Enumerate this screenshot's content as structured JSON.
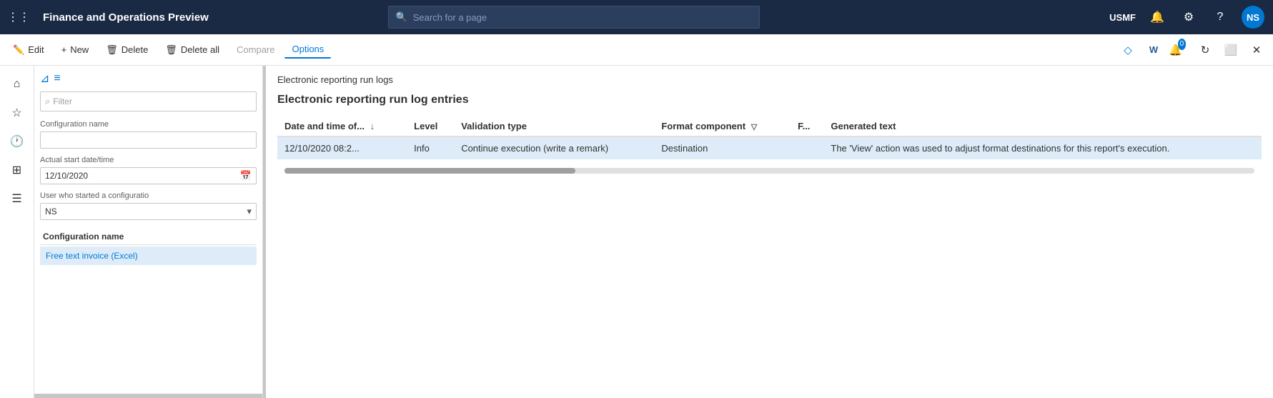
{
  "app": {
    "title": "Finance and Operations Preview",
    "avatar": "NS",
    "user": "USMF"
  },
  "search": {
    "placeholder": "Search for a page"
  },
  "action_bar": {
    "edit_label": "Edit",
    "new_label": "New",
    "delete_label": "Delete",
    "delete_all_label": "Delete all",
    "compare_label": "Compare",
    "options_label": "Options"
  },
  "filter": {
    "placeholder": "Filter",
    "config_name_label": "Configuration name",
    "config_name_value": "",
    "start_date_label": "Actual start date/time",
    "start_date_value": "12/10/2020",
    "user_label": "User who started a configuratio",
    "user_value": "NS",
    "list_column": "Configuration name",
    "list_items": [
      {
        "label": "Free text invoice (Excel)",
        "selected": true
      }
    ]
  },
  "content": {
    "breadcrumb": "Electronic reporting run logs",
    "section_title": "Electronic reporting run log entries",
    "table": {
      "columns": [
        {
          "label": "Date and time of...",
          "sort": true
        },
        {
          "label": "Level"
        },
        {
          "label": "Validation type"
        },
        {
          "label": "Format component",
          "filter": true
        },
        {
          "label": "F..."
        },
        {
          "label": "Generated text"
        }
      ],
      "rows": [
        {
          "date": "12/10/2020 08:2...",
          "level": "Info",
          "validation_type": "Continue execution (write a remark)",
          "format_component": "Destination",
          "f": "",
          "generated_text": "The 'View' action was used to adjust format destinations for this report's execution.",
          "selected": true
        }
      ]
    }
  }
}
